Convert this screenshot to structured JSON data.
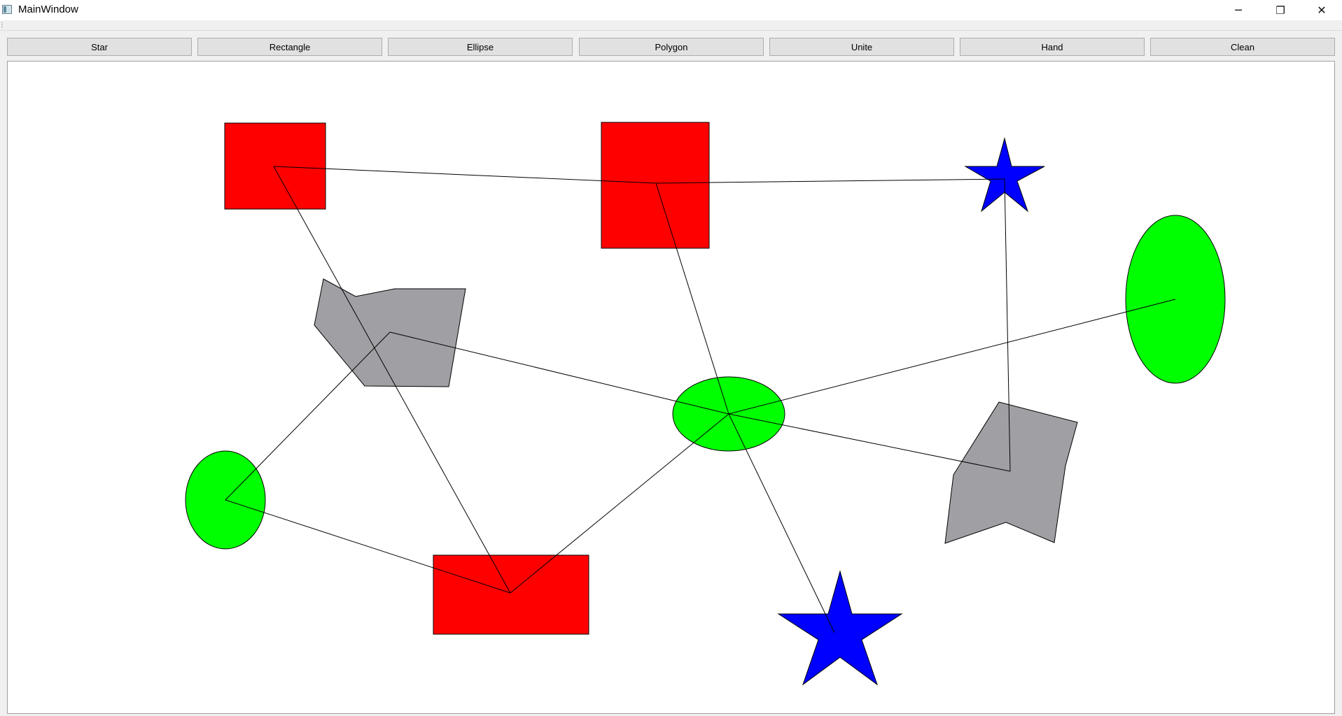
{
  "window": {
    "title": "MainWindow",
    "minimize_glyph": "─",
    "maximize_glyph": "❐",
    "close_glyph": "✕"
  },
  "toolbar": {
    "buttons": [
      "Star",
      "Rectangle",
      "Ellipse",
      "Polygon",
      "Unite",
      "Hand",
      "Clean"
    ]
  },
  "colors": {
    "rectangle_fill": "#ff0000",
    "ellipse_fill": "#00ff00",
    "star_fill": "#0000ff",
    "polygon_fill": "#a0a0a4",
    "outline": "#000000",
    "canvas_background": "#ffffff"
  },
  "canvas": {
    "shape_types": [
      "rectangle",
      "rectangle",
      "rectangle",
      "star",
      "star",
      "ellipse",
      "ellipse",
      "ellipse",
      "polygon",
      "polygon"
    ],
    "connection_count": 12
  }
}
